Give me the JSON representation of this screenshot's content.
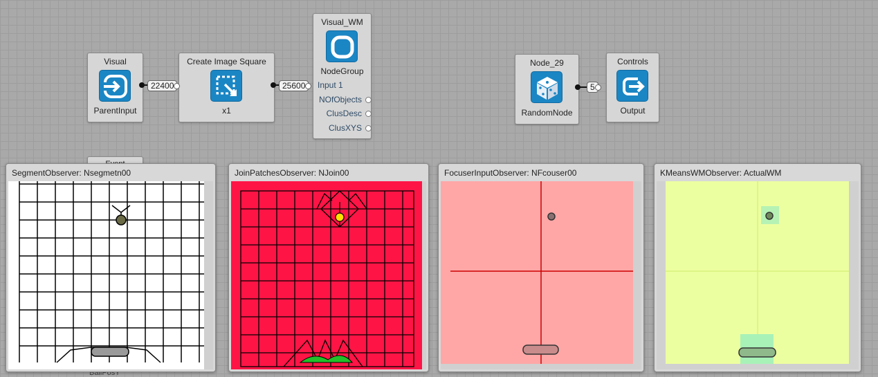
{
  "nodes": {
    "visual": {
      "title": "Visual",
      "sub": "ParentInput",
      "icon": "parent-input-icon"
    },
    "create_image": {
      "title": "Create Image Square",
      "sub": "x1",
      "icon": "image-resize-icon"
    },
    "visual_wm": {
      "title": "Visual_WM",
      "sub": "NodeGroup",
      "icon": "node-group-icon",
      "ports": {
        "input": "Input 1",
        "outputs": [
          "NOfObjects",
          "ClusDesc",
          "ClusXYS"
        ]
      }
    },
    "node29": {
      "title": "Node_29",
      "sub": "RandomNode",
      "icon": "dice-icon"
    },
    "controls": {
      "title": "Controls",
      "sub": "Output",
      "icon": "output-icon"
    }
  },
  "connections": {
    "visual_to_create": "22400",
    "create_to_wm": "25600",
    "node29_to_controls": "5"
  },
  "hidden_nodes": {
    "event": "Event",
    "ballposy": "BallPosY"
  },
  "observers": [
    {
      "title": "SegmentObserver: Nsegmetn00",
      "bg": "#ffffff"
    },
    {
      "title": "JoinPatchesObserver: NJoin00",
      "bg": "#ff1446"
    },
    {
      "title": "FocuserInputObserver: NFcouser00",
      "bg": "#ffa7a7"
    },
    {
      "title": "KMeansWMObserver: ActualWM",
      "bg": "#ecffa0"
    }
  ],
  "colors": {
    "accent": "#1b86c4",
    "canvas_grid": "#a9a9a9",
    "segment_bg": "#ffffff",
    "join_bg": "#ff1446",
    "focuser_bg": "#ffa7a7",
    "kmeans_bg": "#ecffa0",
    "kmeans_cluster": "#a8f2b8"
  }
}
